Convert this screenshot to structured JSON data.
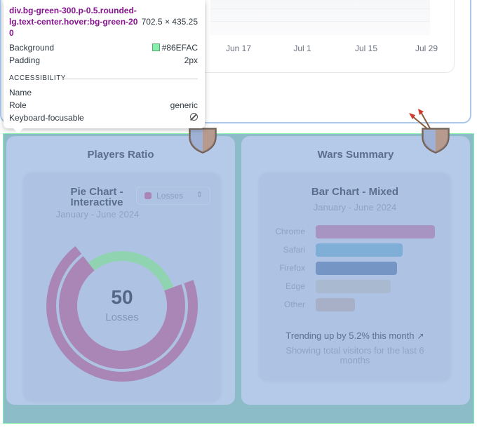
{
  "top_chart": {
    "x_ticks": [
      "Jun 17",
      "Jul 1",
      "Jul 15",
      "Jul 29"
    ]
  },
  "tooltip": {
    "selector": "div.bg-green-300.p-0.5.rounded-lg.text-center.hover:bg-green-200",
    "size": "702.5 × 435.25",
    "background_label": "Background",
    "background_value": "#86EFAC",
    "padding_label": "Padding",
    "padding_value": "2px",
    "section": "ACCESSIBILITY",
    "name_label": "Name",
    "role_label": "Role",
    "role_value": "generic",
    "focus_label": "Keyboard-focusable"
  },
  "players_panel": {
    "title": "Players Ratio",
    "card_title": "Pie Chart - Interactive",
    "subtitle": "January - June 2024",
    "select_value": "Losses",
    "center_value": "50",
    "center_label": "Losses"
  },
  "wars_panel": {
    "title": "Wars Summary",
    "card_title": "Bar Chart - Mixed",
    "subtitle": "January - June 2024",
    "trend_text": "Trending up by 5.2% this month",
    "footer": "Showing total visitors for the last 6 months"
  },
  "colors": {
    "highlight": "#86EFAC",
    "losses": "#a986b6",
    "wins": "#8fd3b0"
  },
  "chart_data": [
    {
      "type": "pie",
      "title": "Pie Chart - Interactive",
      "subtitle": "January - June 2024",
      "center_value": 50,
      "center_label": "Losses",
      "slices": [
        {
          "name": "Losses",
          "value": 70,
          "color": "#a986b6"
        },
        {
          "name": "",
          "value": 30,
          "color": "#8fd3b0"
        }
      ]
    },
    {
      "type": "bar",
      "title": "Bar Chart - Mixed",
      "subtitle": "January - June 2024",
      "orientation": "horizontal",
      "categories": [
        "Chrome",
        "Safari",
        "Firefox",
        "Edge",
        "Other"
      ],
      "values": [
        275,
        200,
        187,
        173,
        90
      ],
      "colors": [
        "#a894c2",
        "#7faed6",
        "#7595c4",
        "#a9bad0",
        "#a7b0c6"
      ],
      "xlim": [
        0,
        275
      ]
    }
  ]
}
